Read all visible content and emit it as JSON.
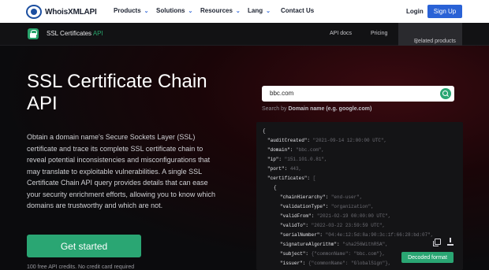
{
  "topnav": {
    "logo": "WhoisXMLAPI",
    "items": [
      "Products",
      "Solutions",
      "Resources",
      "Lang",
      "Contact Us"
    ],
    "login": "Login",
    "signup": "Sign Up"
  },
  "subnav": {
    "title": "SSL Certificates",
    "title_accent": "API",
    "links": [
      "API docs",
      "Pricing"
    ],
    "related": "Related products"
  },
  "hero": {
    "title": "SSL Certificate Chain API",
    "description": "Obtain a domain name's Secure Sockets Layer (SSL) certificate and trace its complete SSL certificate chain to reveal potential inconsistencies and misconfigurations that may translate to exploitable vulnerabilities. A single SSL Certificate Chain API query provides details that can ease your security enrichment efforts, allowing you to know which domains are trustworthy and which are not.",
    "cta": "Get started",
    "fine_print": "100 free API credits. No credit card required"
  },
  "search": {
    "value": "bbc.com",
    "hint_prefix": "Search by",
    "hint_strong": "Domain name (e.g. google.com)"
  },
  "code": {
    "lines": [
      {
        "key": "{",
        "val": ""
      },
      {
        "key": "\"auditCreated\":",
        "val": " \"2021-09-14 12:00:00 UTC\","
      },
      {
        "key": "\"domain\":",
        "val": " \"bbc.com\","
      },
      {
        "key": "\"ip\":",
        "val": " \"151.101.0.81\","
      },
      {
        "key": "\"port\":",
        "val": " 443,"
      },
      {
        "key": "\"certificates\":",
        "val": " ["
      },
      {
        "key": "{",
        "val": ""
      },
      {
        "key": "\"chainHierarchy\":",
        "val": " \"end-user\","
      },
      {
        "key": "\"validationType\":",
        "val": " \"organization\","
      },
      {
        "key": "\"validFrom\":",
        "val": " \"2021-02-19 00:00:00 UTC\","
      },
      {
        "key": "\"validTo\":",
        "val": " \"2022-03-22 23:59:59 UTC\","
      },
      {
        "key": "\"serialNumber\":",
        "val": " \"04:4e:12:5d:8a:90:3c:1f:66:28:bd:07\","
      },
      {
        "key": "\"signatureAlgorithm\":",
        "val": " \"sha256WithRSA\","
      },
      {
        "key": "\"subject\":",
        "val": " {\"commonName\": \"bbc.com\"},"
      },
      {
        "key": "\"issuer\":",
        "val": " {\"commonName\": \"GlobalSign\"},"
      }
    ],
    "decoded_button": "Decoded format"
  }
}
